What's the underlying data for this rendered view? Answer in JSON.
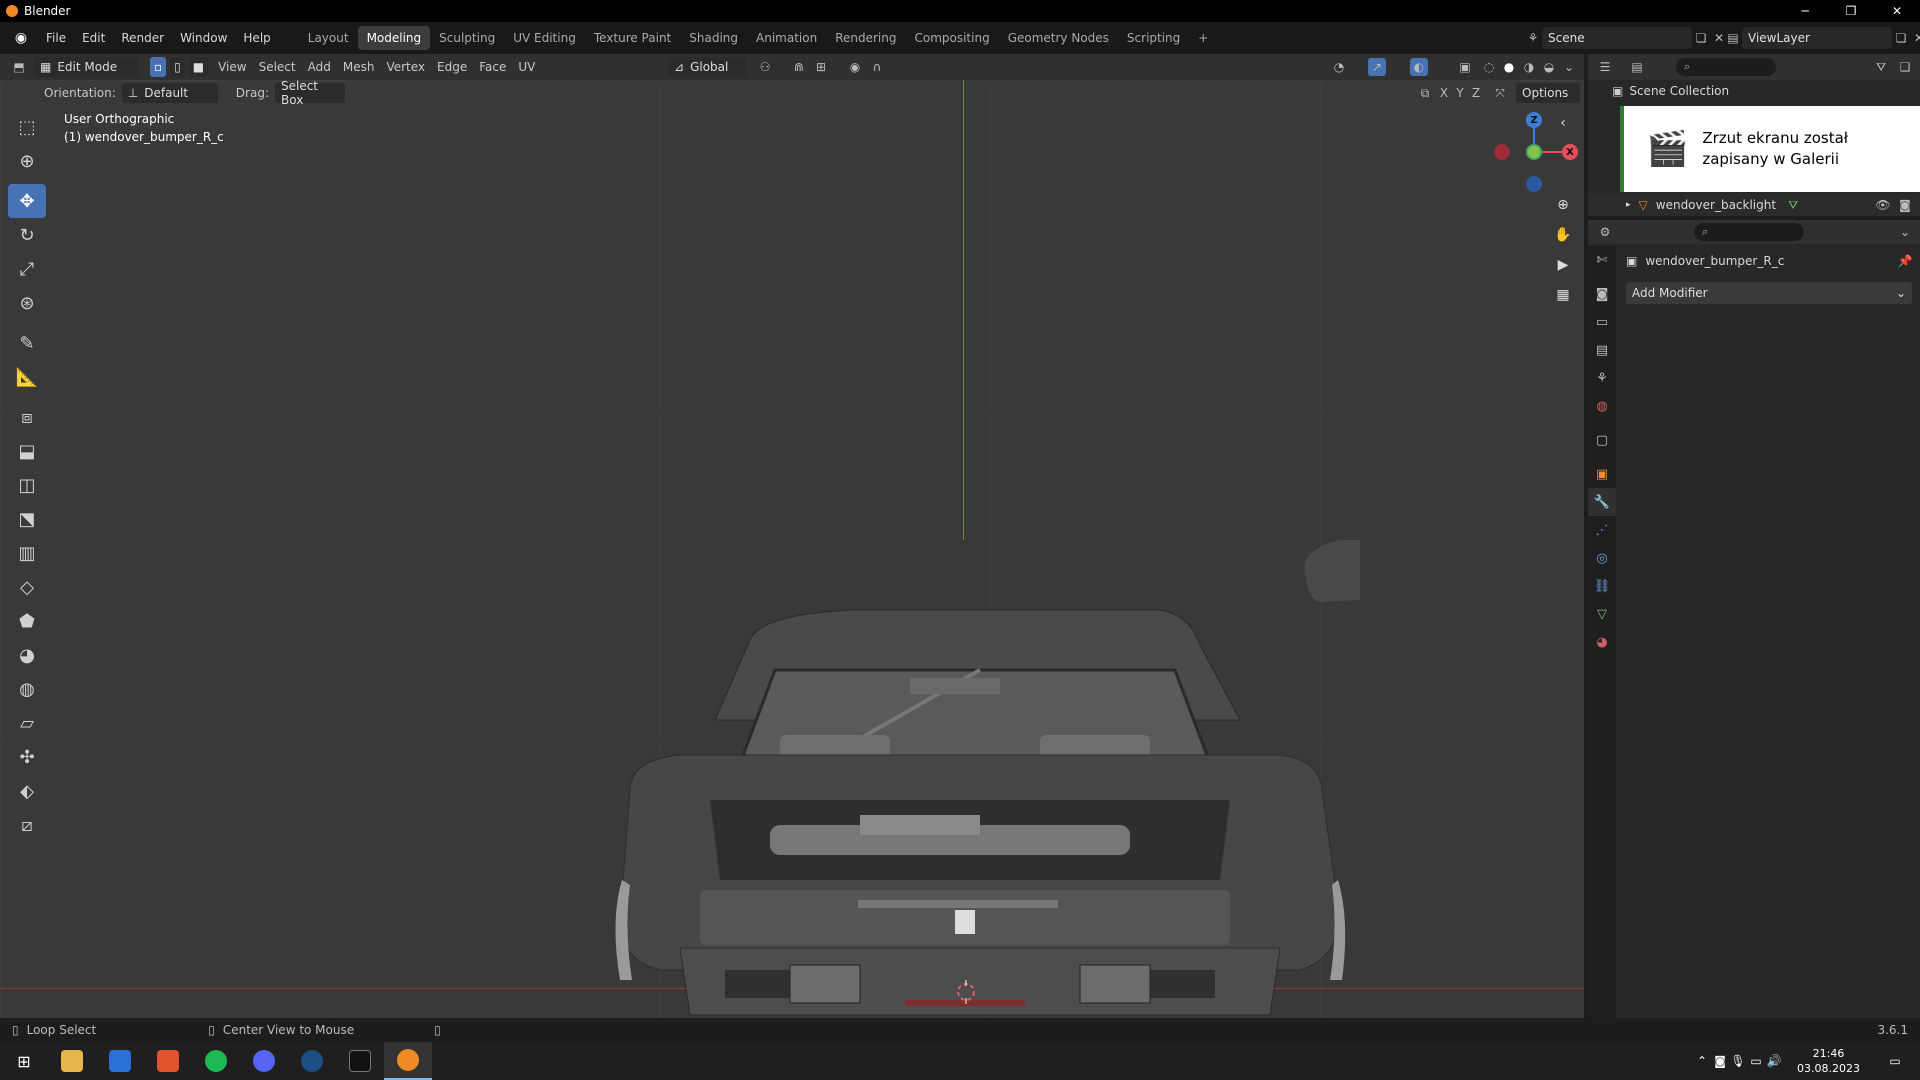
{
  "window": {
    "title": "Blender",
    "minimize": "─",
    "maximize": "❐",
    "close": "✕"
  },
  "menu": [
    "File",
    "Edit",
    "Render",
    "Window",
    "Help"
  ],
  "workspaces": [
    "Layout",
    "Modeling",
    "Sculpting",
    "UV Editing",
    "Texture Paint",
    "Shading",
    "Animation",
    "Rendering",
    "Compositing",
    "Geometry Nodes",
    "Scripting"
  ],
  "workspace_add": "+",
  "scene": "Scene",
  "view_layer": "ViewLayer",
  "viewport_header": {
    "mode": "Edit Mode",
    "menus": [
      "View",
      "Select",
      "Add",
      "Mesh",
      "Vertex",
      "Edge",
      "Face",
      "UV"
    ],
    "transform_orientation": "Global",
    "orientation_label": "Orientation:",
    "orientation_value": "Default",
    "drag_label": "Drag:",
    "drag_value": "Select Box",
    "axes": [
      "X",
      "Y",
      "Z"
    ],
    "options": "Options"
  },
  "viewport_info": {
    "view": "User Orthographic",
    "object": "(1) wendover_bumper_R_c"
  },
  "gizmo": {
    "z": "Z",
    "x": "X"
  },
  "outliner": {
    "root": "Scene Collection",
    "item": "wendover_backlight"
  },
  "toast": {
    "line1": "Zrzut ekranu został",
    "line2": "zapisany w Galerii"
  },
  "properties": {
    "object_name": "wendover_bumper_R_c",
    "add_modifier": "Add Modifier"
  },
  "statusbar": {
    "left": "Loop Select",
    "middle": "Center View to Mouse",
    "version": "3.6.1"
  },
  "taskbar": {
    "time": "21:46",
    "date": "03.08.2023"
  },
  "colors": {
    "accent": "#4772b3",
    "axis_x": "#e64c5a",
    "axis_y": "#8bc34a",
    "axis_z": "#3d7fd8",
    "blender_orange": "#ef8a25"
  }
}
